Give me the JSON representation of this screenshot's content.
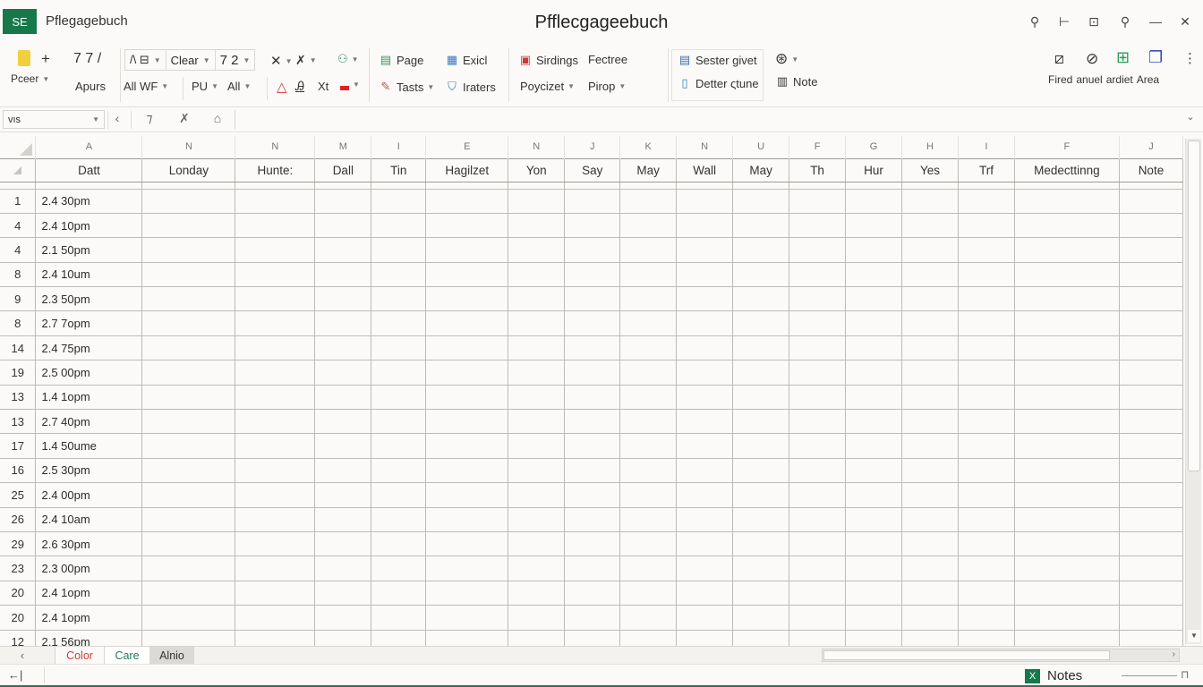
{
  "app": {
    "badge": "SE",
    "document_name": "Pflegagebuch",
    "window_title": "Pfflecgageebuch",
    "window_controls": [
      {
        "name": "search-icon",
        "glyph": "⚲"
      },
      {
        "name": "pin-icon",
        "glyph": "⊢"
      },
      {
        "name": "restore-icon",
        "glyph": "⊡"
      },
      {
        "name": "zoom-search-icon",
        "glyph": "⚲"
      },
      {
        "name": "minimize-icon",
        "glyph": "—"
      },
      {
        "name": "close-icon",
        "glyph": "✕"
      }
    ]
  },
  "ribbon": {
    "paste_label": "Pceer",
    "plus_label": "+",
    "font_nums": "7  7  /",
    "apurs_label": "Apurs",
    "font_box": {
      "style": "/\\ ⊟",
      "font": "Clear",
      "size": "7 2"
    },
    "all_wf_label": "All  WF",
    "pu_label": "PU",
    "all_label": "All",
    "xt_label": "Xt",
    "page_label": "Page",
    "exicl_label": "Exicl",
    "tasts_label": "Tasts",
    "iraters_label": "Iraters",
    "sirdings_label": "Sirdings",
    "fectree_label": "Fectree",
    "poycizet_label": "Poycizet",
    "pirop_label": "Pirop",
    "sester_label": "Sester givet",
    "detter_label": "Detter ςtune",
    "note_label": "Note",
    "right_group": [
      "Fired",
      "anuel",
      "ardiet",
      "Area"
    ]
  },
  "formula_bar": {
    "name_box": "vıs",
    "value": ""
  },
  "sheet": {
    "column_letters": [
      "A",
      "N",
      "N",
      "M",
      "I",
      "E",
      "N",
      "J",
      "K",
      "N",
      "U",
      "F",
      "G",
      "H",
      "I",
      "F",
      "J"
    ],
    "headers": [
      "Datt",
      "Londay",
      "Hunte:",
      "Dall",
      "Tin",
      "Hagilzet",
      "Yon",
      "Say",
      "May",
      "Wall",
      "May",
      "Th",
      "Hur",
      "Yes",
      "Trf",
      "Medecttinng",
      "Note"
    ],
    "rows": [
      {
        "num": "1",
        "time": "2.4 30pm"
      },
      {
        "num": "4",
        "time": "2.4 10pm"
      },
      {
        "num": "4",
        "time": "2.1 50pm"
      },
      {
        "num": "8",
        "time": "2.4 10um"
      },
      {
        "num": "9",
        "time": "2.3 50pm"
      },
      {
        "num": "8",
        "time": "2.7 7opm"
      },
      {
        "num": "14",
        "time": "2.4 75pm"
      },
      {
        "num": "19",
        "time": "2.5 00pm"
      },
      {
        "num": "13",
        "time": "1.4 1opm"
      },
      {
        "num": "13",
        "time": "2.7 40pm"
      },
      {
        "num": "17",
        "time": "1.4 50ume"
      },
      {
        "num": "16",
        "time": "2.5 30pm"
      },
      {
        "num": "25",
        "time": "2.4 00pm"
      },
      {
        "num": "26",
        "time": "2.4 10am"
      },
      {
        "num": "29",
        "time": "2.6 30pm"
      },
      {
        "num": "23",
        "time": "2.3 00pm"
      },
      {
        "num": "20",
        "time": "2.4 1opm"
      },
      {
        "num": "20",
        "time": "2.4 1opm"
      },
      {
        "num": "12",
        "time": "2.1 56pm"
      }
    ]
  },
  "tabs": [
    {
      "label": "Color",
      "color": "#d23b3b"
    },
    {
      "label": "Care",
      "color": "#1f7a5c"
    },
    {
      "label": "Alnio",
      "color": "#333333"
    }
  ],
  "status": {
    "back_label": "←|",
    "notes_label": "Notes",
    "brand_color": "#17784a"
  }
}
